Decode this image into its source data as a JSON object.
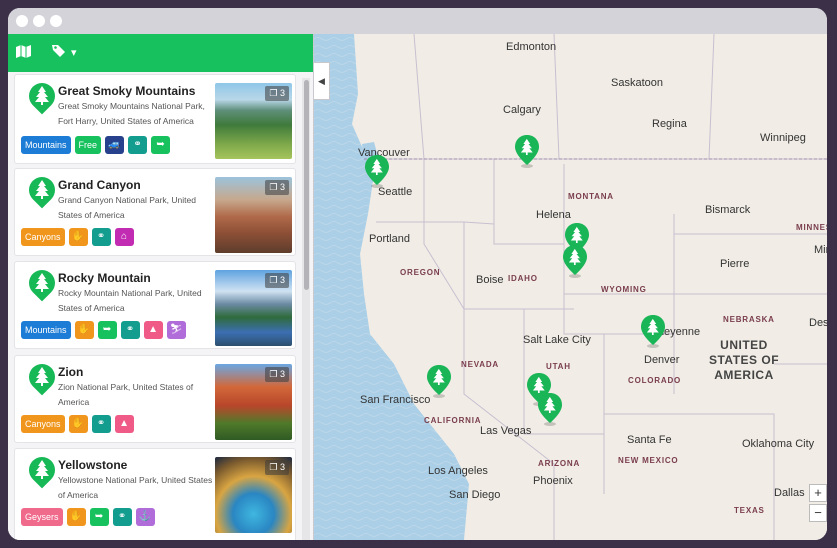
{
  "window": {
    "dots": [
      "",
      "",
      ""
    ]
  },
  "toolbar": {
    "map_icon": "map-icon",
    "tags_icon": "tags-icon",
    "chevron": "▾"
  },
  "parks": [
    {
      "title": "Great Smoky Mountains",
      "address": "Great Smoky Mountains National Park, Fort Harry, United States of America",
      "photos": "3",
      "category": "Mountains",
      "extra_tag": "Free"
    },
    {
      "title": "Grand Canyon",
      "address": "Grand Canyon National Park, United States of America",
      "photos": "3",
      "category": "Canyons"
    },
    {
      "title": "Rocky Mountain",
      "address": "Rocky Mountain National Park, United States of America",
      "photos": "3",
      "category": "Mountains"
    },
    {
      "title": "Zion",
      "address": "Zion National Park, United States of America",
      "photos": "3",
      "category": "Canyons"
    },
    {
      "title": "Yellowstone",
      "address": "Yellowstone National Park, United States of America",
      "photos": "3",
      "category": "Geysers"
    }
  ],
  "colors": {
    "green": "#17c25e",
    "mountains": "#1c7cd6",
    "canyons": "#f0961c",
    "geysers": "#f06a8c",
    "teal": "#129d8f",
    "pink": "#f05a86",
    "magenta": "#c22cb2",
    "navy": "#27418c",
    "purple": "#b06cd8"
  },
  "map": {
    "cities": [
      "Edmonton",
      "Saskatoon",
      "Calgary",
      "Regina",
      "Winnipeg",
      "Vancouver",
      "Seattle",
      "Helena",
      "Bismarck",
      "Portland",
      "Boise",
      "Pierre",
      "Des M",
      "Salt Lake City",
      "Cheyenne",
      "Denver",
      "San Francisco",
      "Las Vegas",
      "Santa Fe",
      "Oklahoma City",
      "Los Angeles",
      "Phoenix",
      "San Diego",
      "Dallas"
    ],
    "states": [
      "MONTANA",
      "OREGON",
      "IDAHO",
      "WYOMING",
      "NEBRASKA",
      "MINNESO",
      "Minn",
      "NEVADA",
      "UTAH",
      "COLORADO",
      "CALIFORNIA",
      "ARIZONA",
      "NEW MEXICO",
      "TEXAS"
    ],
    "country": "UNITED STATES OF AMERICA",
    "zoom": [
      "+",
      "−"
    ]
  }
}
